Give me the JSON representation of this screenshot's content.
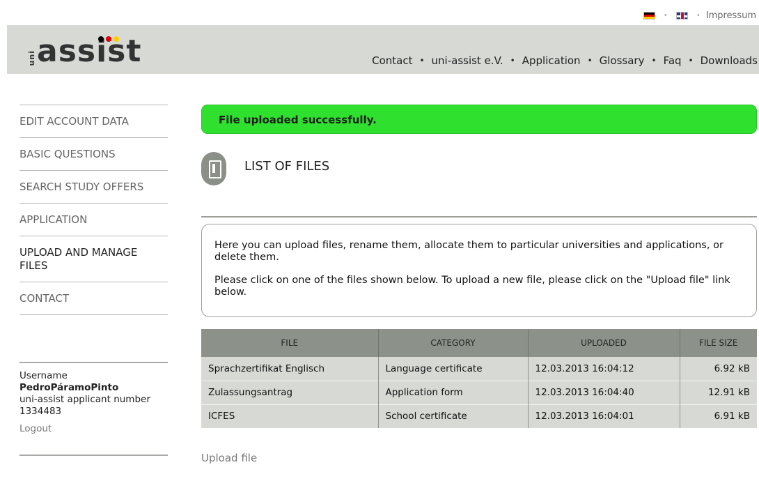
{
  "topbar": {
    "impressum": "Impressum",
    "separator": "•"
  },
  "logo": {
    "uni": "uni",
    "main": "assist",
    "dot_colors": [
      "#000000",
      "#dd0000",
      "#ffce00"
    ]
  },
  "nav": {
    "separator": "•",
    "items": [
      {
        "label": "Contact"
      },
      {
        "label": "uni-assist e.V."
      },
      {
        "label": "Application"
      },
      {
        "label": "Glossary"
      },
      {
        "label": "Faq"
      },
      {
        "label": "Downloads"
      }
    ]
  },
  "sidebar": {
    "items": [
      {
        "label": "EDIT ACCOUNT DATA"
      },
      {
        "label": "BASIC QUESTIONS"
      },
      {
        "label": "SEARCH STUDY OFFERS"
      },
      {
        "label": "APPLICATION"
      },
      {
        "label": "UPLOAD AND MANAGE FILES"
      },
      {
        "label": "CONTACT"
      }
    ]
  },
  "user": {
    "username_label": "Username",
    "username": "PedroPáramoPinto",
    "number_label": "uni-assist applicant number",
    "number": "1334483",
    "logout": "Logout"
  },
  "main": {
    "success_message": "File uploaded successfully.",
    "section_title": "LIST OF FILES",
    "info_p1": "Here you can upload files, rename them, allocate them to particular universities and applications, or delete them.",
    "info_p2": "Please click on one of the files shown below. To upload a new file, please click on the \"Upload file\" link below.",
    "upload_link": "Upload file"
  },
  "table": {
    "headers": {
      "file": "FILE",
      "category": "CATEGORY",
      "uploaded": "UPLOADED",
      "size": "FILE SIZE"
    },
    "rows": [
      {
        "file": "Sprachzertifikat Englisch",
        "category": "Language certificate",
        "uploaded": "12.03.2013 16:04:12",
        "size": "6.92 kB"
      },
      {
        "file": "Zulassungsantrag",
        "category": "Application form",
        "uploaded": "12.03.2013 16:04:40",
        "size": "12.91 kB"
      },
      {
        "file": "ICFES",
        "category": "School certificate",
        "uploaded": "12.03.2013 16:04:01",
        "size": "6.91 kB"
      }
    ]
  },
  "colors": {
    "success": "#2fe02f",
    "header_band": "#d6d9d4",
    "table_head": "#8c9289"
  }
}
